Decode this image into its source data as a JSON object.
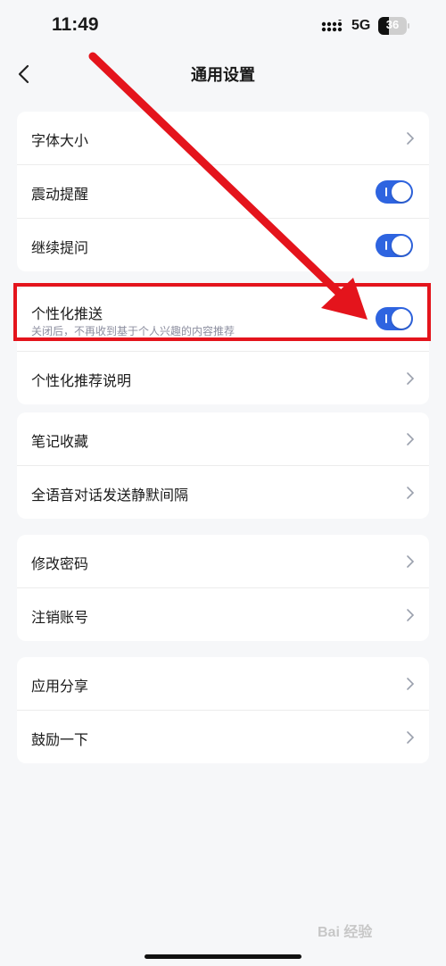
{
  "status_bar": {
    "time": "11:49",
    "network": "5G",
    "battery": "36",
    "battery_level": 0.36
  },
  "nav": {
    "title": "通用设置",
    "back_icon": "chevron-left-icon"
  },
  "groups": [
    {
      "items": [
        {
          "label": "字体大小",
          "type": "link"
        },
        {
          "label": "震动提醒",
          "type": "toggle",
          "on": true
        },
        {
          "label": "继续提问",
          "type": "toggle",
          "on": true
        }
      ]
    },
    {
      "items": [
        {
          "label": "个性化推送",
          "subtitle": "关闭后，不再收到基于个人兴趣的内容推荐",
          "type": "toggle",
          "on": true
        },
        {
          "label": "个性化推荐说明",
          "type": "link"
        }
      ]
    },
    {
      "items": [
        {
          "label": "笔记收藏",
          "type": "link"
        },
        {
          "label": "全语音对话发送静默间隔",
          "type": "link"
        }
      ]
    },
    {
      "items": [
        {
          "label": "修改密码",
          "type": "link"
        },
        {
          "label": "注销账号",
          "type": "link"
        }
      ]
    },
    {
      "items": [
        {
          "label": "应用分享",
          "type": "link"
        },
        {
          "label": "鼓励一下",
          "type": "link"
        }
      ]
    }
  ],
  "annotation": {
    "highlight_color": "#e4141c"
  },
  "colors": {
    "toggle_on": "#2e64e0",
    "background": "#f6f7f9"
  },
  "watermark": "Bai 经验"
}
